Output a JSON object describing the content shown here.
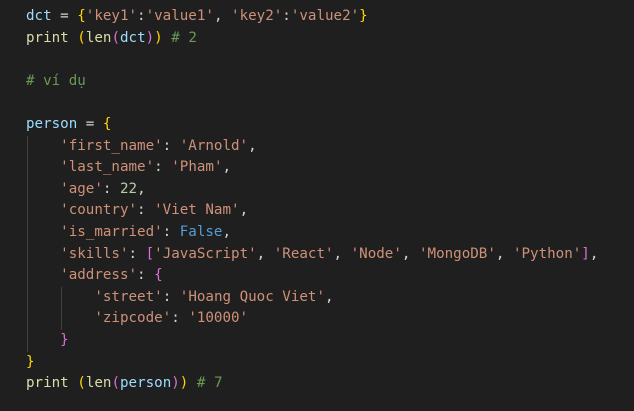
{
  "editor": {
    "lines": [
      [
        {
          "t": "dct",
          "c": "var",
          "n": "var-token"
        },
        {
          "t": " = ",
          "c": "op",
          "n": "operator-token"
        },
        {
          "t": "{",
          "c": "b1",
          "n": "bracket-token"
        },
        {
          "t": "'key1'",
          "c": "str",
          "n": "string-token"
        },
        {
          "t": ":",
          "c": "op",
          "n": "operator-token"
        },
        {
          "t": "'value1'",
          "c": "str",
          "n": "string-token"
        },
        {
          "t": ", ",
          "c": "op",
          "n": "operator-token"
        },
        {
          "t": "'key2'",
          "c": "str",
          "n": "string-token"
        },
        {
          "t": ":",
          "c": "op",
          "n": "operator-token"
        },
        {
          "t": "'value2'",
          "c": "str",
          "n": "string-token"
        },
        {
          "t": "}",
          "c": "b1",
          "n": "bracket-token"
        }
      ],
      [
        {
          "t": "print",
          "c": "fn",
          "n": "function-token"
        },
        {
          "t": " ",
          "c": "op",
          "n": "whitespace-token"
        },
        {
          "t": "(",
          "c": "b1",
          "n": "bracket-token"
        },
        {
          "t": "len",
          "c": "fn",
          "n": "function-token"
        },
        {
          "t": "(",
          "c": "b2",
          "n": "bracket-token"
        },
        {
          "t": "dct",
          "c": "var",
          "n": "var-token"
        },
        {
          "t": ")",
          "c": "b2",
          "n": "bracket-token"
        },
        {
          "t": ")",
          "c": "b1",
          "n": "bracket-token"
        },
        {
          "t": " # 2",
          "c": "cmt",
          "n": "comment-token"
        }
      ],
      [],
      [
        {
          "t": "# ví dụ",
          "c": "cmt",
          "n": "comment-token"
        }
      ],
      [],
      [
        {
          "t": "person",
          "c": "var",
          "n": "var-token"
        },
        {
          "t": " = ",
          "c": "op",
          "n": "operator-token"
        },
        {
          "t": "{",
          "c": "b1",
          "n": "bracket-token"
        }
      ],
      [
        {
          "t": "    ",
          "c": "op",
          "n": "whitespace-token"
        },
        {
          "t": "'first_name'",
          "c": "str",
          "n": "string-token"
        },
        {
          "t": ": ",
          "c": "op",
          "n": "operator-token"
        },
        {
          "t": "'Arnold'",
          "c": "str",
          "n": "string-token"
        },
        {
          "t": ",",
          "c": "op",
          "n": "operator-token"
        }
      ],
      [
        {
          "t": "    ",
          "c": "op",
          "n": "whitespace-token"
        },
        {
          "t": "'last_name'",
          "c": "str",
          "n": "string-token"
        },
        {
          "t": ": ",
          "c": "op",
          "n": "operator-token"
        },
        {
          "t": "'Pham'",
          "c": "str",
          "n": "string-token"
        },
        {
          "t": ",",
          "c": "op",
          "n": "operator-token"
        }
      ],
      [
        {
          "t": "    ",
          "c": "op",
          "n": "whitespace-token"
        },
        {
          "t": "'age'",
          "c": "str",
          "n": "string-token"
        },
        {
          "t": ": ",
          "c": "op",
          "n": "operator-token"
        },
        {
          "t": "22",
          "c": "num",
          "n": "number-token"
        },
        {
          "t": ",",
          "c": "op",
          "n": "operator-token"
        }
      ],
      [
        {
          "t": "    ",
          "c": "op",
          "n": "whitespace-token"
        },
        {
          "t": "'country'",
          "c": "str",
          "n": "string-token"
        },
        {
          "t": ": ",
          "c": "op",
          "n": "operator-token"
        },
        {
          "t": "'Viet Nam'",
          "c": "str",
          "n": "string-token"
        },
        {
          "t": ",",
          "c": "op",
          "n": "operator-token"
        }
      ],
      [
        {
          "t": "    ",
          "c": "op",
          "n": "whitespace-token"
        },
        {
          "t": "'is_married'",
          "c": "str",
          "n": "string-token"
        },
        {
          "t": ": ",
          "c": "op",
          "n": "operator-token"
        },
        {
          "t": "False",
          "c": "kw",
          "n": "keyword-token"
        },
        {
          "t": ",",
          "c": "op",
          "n": "operator-token"
        }
      ],
      [
        {
          "t": "    ",
          "c": "op",
          "n": "whitespace-token"
        },
        {
          "t": "'skills'",
          "c": "str",
          "n": "string-token"
        },
        {
          "t": ": ",
          "c": "op",
          "n": "operator-token"
        },
        {
          "t": "[",
          "c": "b2",
          "n": "bracket-token"
        },
        {
          "t": "'JavaScript'",
          "c": "str",
          "n": "string-token"
        },
        {
          "t": ", ",
          "c": "op",
          "n": "operator-token"
        },
        {
          "t": "'React'",
          "c": "str",
          "n": "string-token"
        },
        {
          "t": ", ",
          "c": "op",
          "n": "operator-token"
        },
        {
          "t": "'Node'",
          "c": "str",
          "n": "string-token"
        },
        {
          "t": ", ",
          "c": "op",
          "n": "operator-token"
        },
        {
          "t": "'MongoDB'",
          "c": "str",
          "n": "string-token"
        },
        {
          "t": ", ",
          "c": "op",
          "n": "operator-token"
        },
        {
          "t": "'Python'",
          "c": "str",
          "n": "string-token"
        },
        {
          "t": "]",
          "c": "b2",
          "n": "bracket-token"
        },
        {
          "t": ",",
          "c": "op",
          "n": "operator-token"
        }
      ],
      [
        {
          "t": "    ",
          "c": "op",
          "n": "whitespace-token"
        },
        {
          "t": "'address'",
          "c": "str",
          "n": "string-token"
        },
        {
          "t": ": ",
          "c": "op",
          "n": "operator-token"
        },
        {
          "t": "{",
          "c": "b2",
          "n": "bracket-token"
        }
      ],
      [
        {
          "t": "        ",
          "c": "op",
          "n": "whitespace-token"
        },
        {
          "t": "'street'",
          "c": "str",
          "n": "string-token"
        },
        {
          "t": ": ",
          "c": "op",
          "n": "operator-token"
        },
        {
          "t": "'Hoang Quoc Viet'",
          "c": "str",
          "n": "string-token"
        },
        {
          "t": ",",
          "c": "op",
          "n": "operator-token"
        }
      ],
      [
        {
          "t": "        ",
          "c": "op",
          "n": "whitespace-token"
        },
        {
          "t": "'zipcode'",
          "c": "str",
          "n": "string-token"
        },
        {
          "t": ": ",
          "c": "op",
          "n": "operator-token"
        },
        {
          "t": "'10000'",
          "c": "str",
          "n": "string-token"
        }
      ],
      [
        {
          "t": "    ",
          "c": "op",
          "n": "whitespace-token"
        },
        {
          "t": "}",
          "c": "b2",
          "n": "bracket-token"
        }
      ],
      [
        {
          "t": "}",
          "c": "b1",
          "n": "bracket-token"
        }
      ],
      [
        {
          "t": "print",
          "c": "fn",
          "n": "function-token"
        },
        {
          "t": " ",
          "c": "op",
          "n": "whitespace-token"
        },
        {
          "t": "(",
          "c": "b1",
          "n": "bracket-token"
        },
        {
          "t": "len",
          "c": "fn",
          "n": "function-token"
        },
        {
          "t": "(",
          "c": "b2",
          "n": "bracket-token"
        },
        {
          "t": "person",
          "c": "var",
          "n": "var-token"
        },
        {
          "t": ")",
          "c": "b2",
          "n": "bracket-token"
        },
        {
          "t": ")",
          "c": "b1",
          "n": "bracket-token"
        },
        {
          "t": " # 7",
          "c": "cmt",
          "n": "comment-token"
        }
      ]
    ],
    "colors": {
      "background": "#1f1f1f",
      "variable": "#9cdcfe",
      "string": "#ce9178",
      "function": "#dcdcaa",
      "number": "#b5cea8",
      "keyword": "#569cd6",
      "comment": "#6a9955",
      "bracket_level_1": "#ffd700",
      "bracket_level_2": "#da70d6",
      "indent_guide": "#404040"
    }
  }
}
